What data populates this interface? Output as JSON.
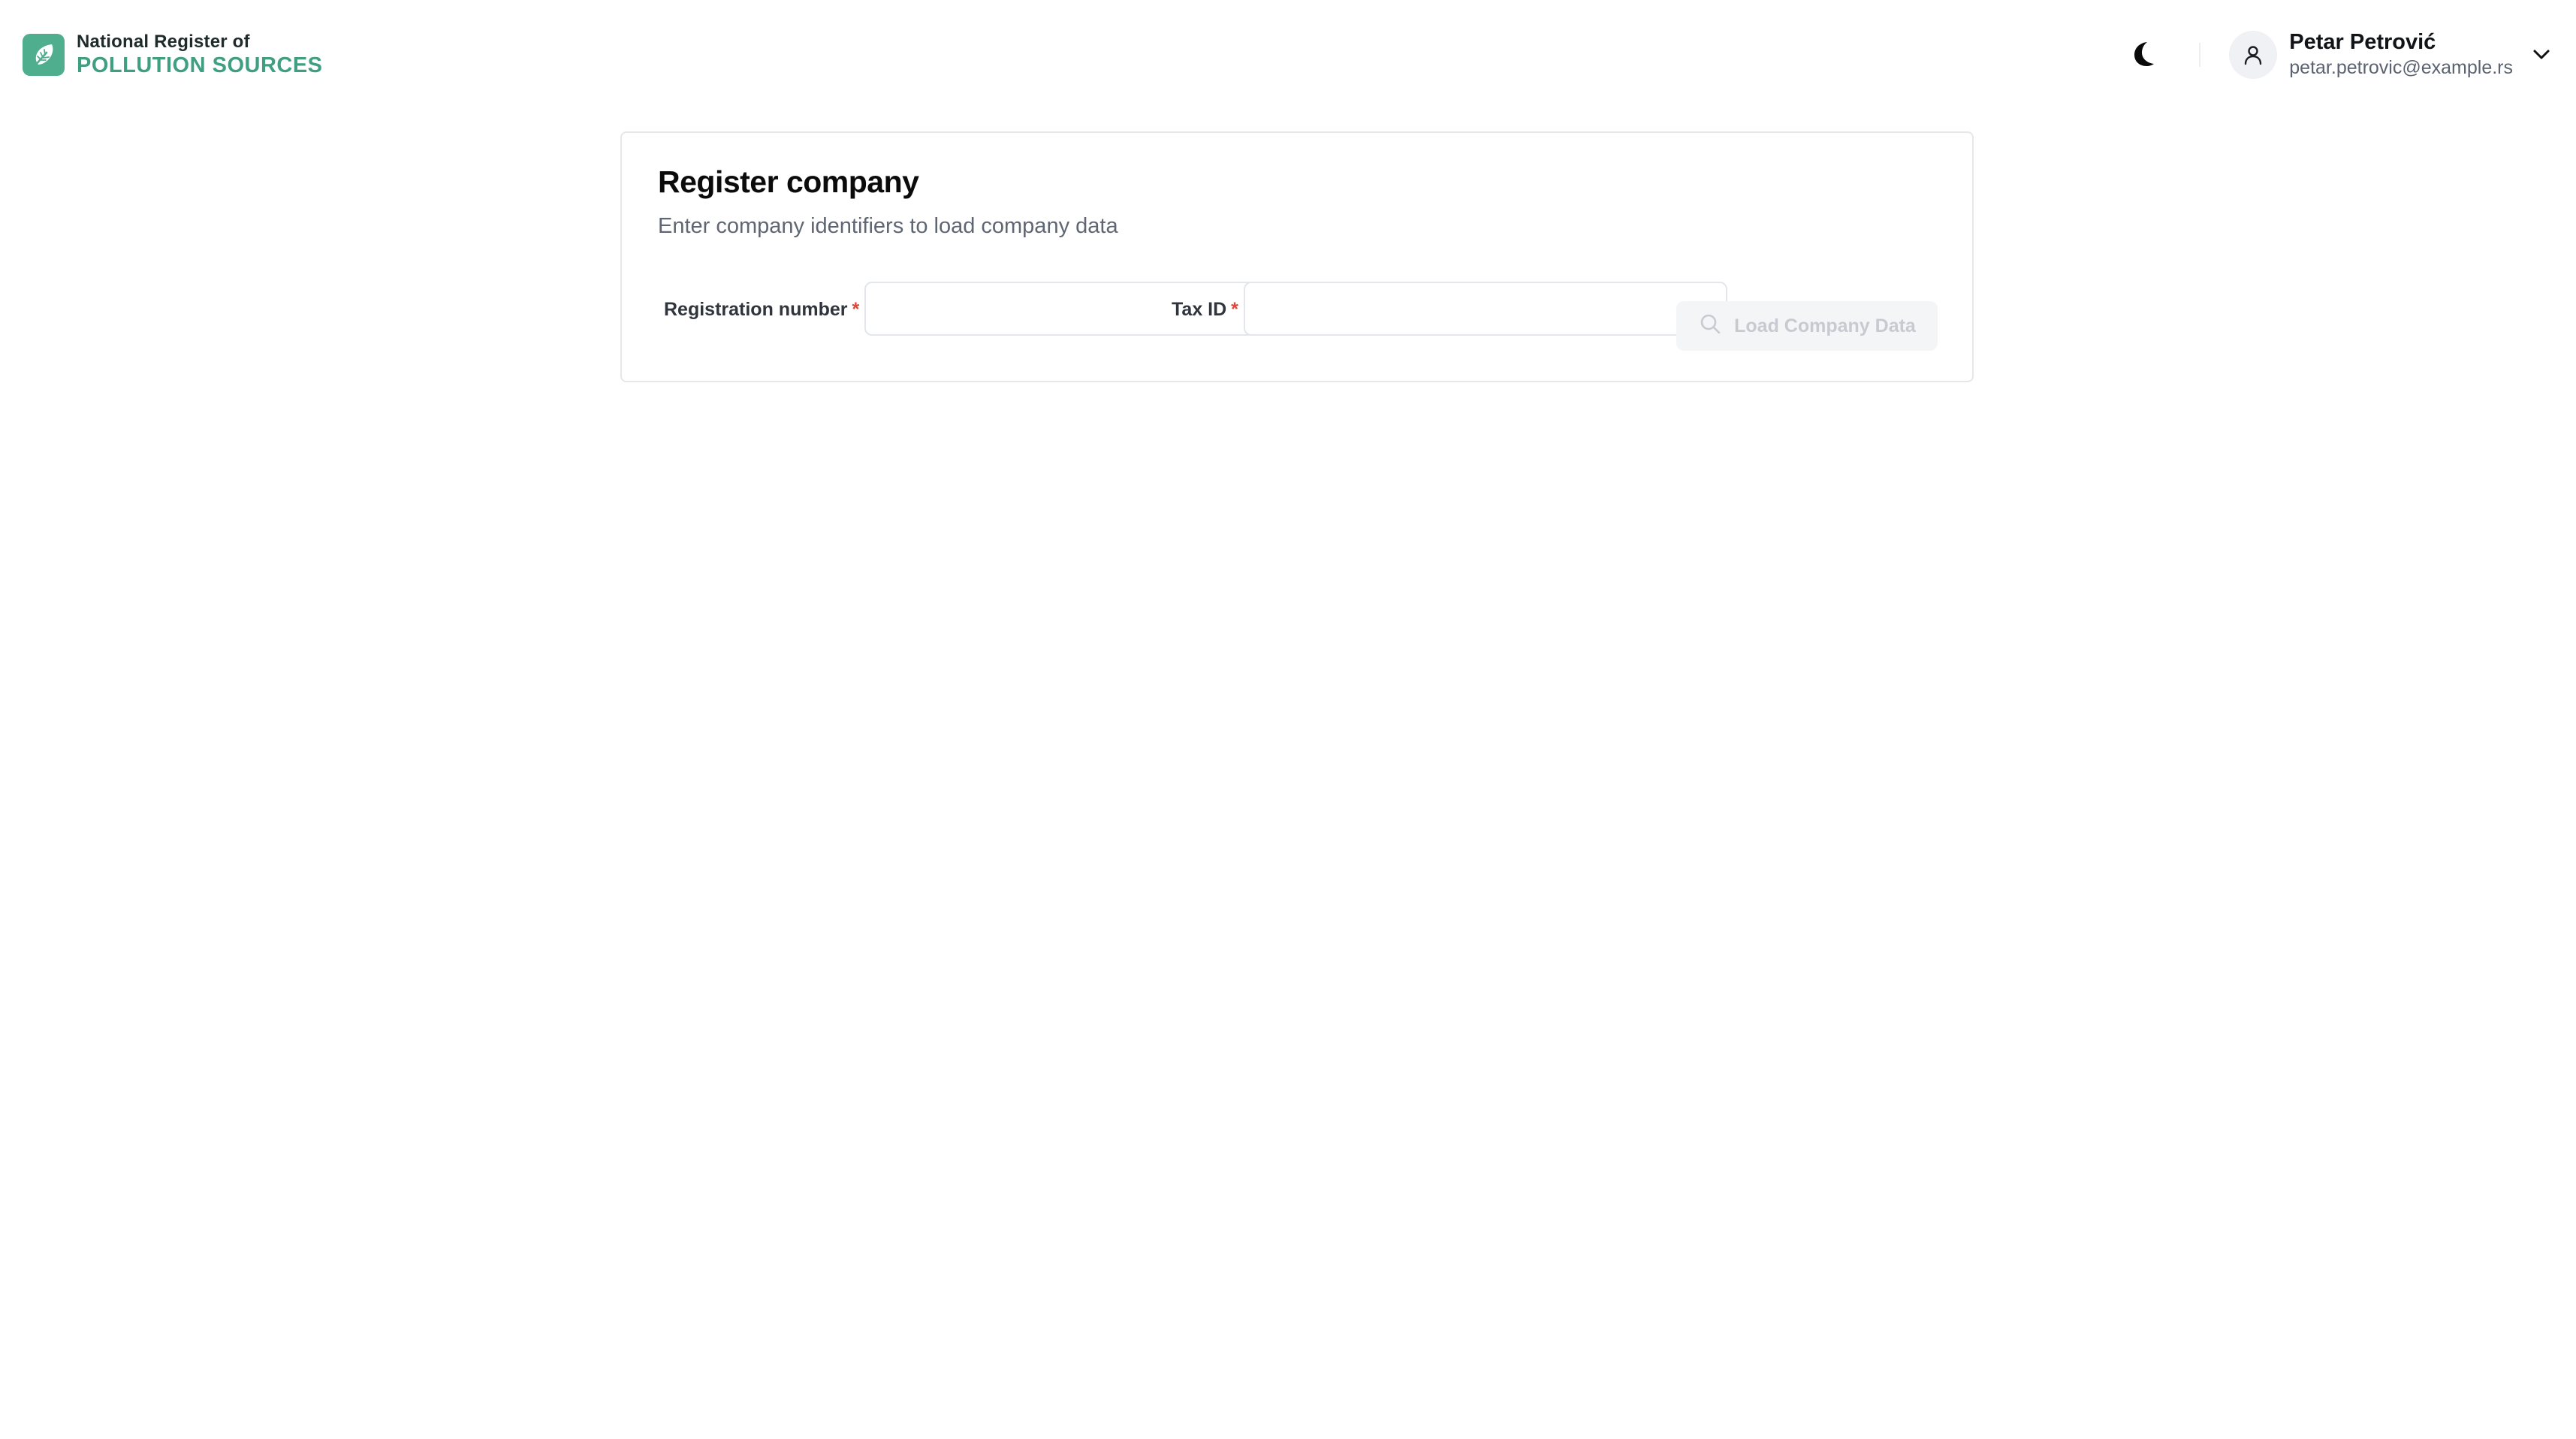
{
  "brand": {
    "line1": "National Register of",
    "line2": "POLLUTION SOURCES",
    "logo_icon": "leaf-icon",
    "accent_color": "#4fae8e"
  },
  "header": {
    "theme_toggle_icon": "moon-icon",
    "user": {
      "name": "Petar Petrović",
      "email": "petar.petrovic@example.rs",
      "avatar_icon": "user-icon",
      "menu_icon": "chevron-down-icon"
    }
  },
  "card": {
    "title": "Register company",
    "subtitle": "Enter company identifiers to load company data",
    "fields": {
      "registration": {
        "label": "Registration number",
        "required_mark": "*",
        "value": "",
        "placeholder": ""
      },
      "tax": {
        "label": "Tax ID",
        "required_mark": "*",
        "value": "",
        "placeholder": ""
      }
    },
    "load_button": {
      "label": "Load Company Data",
      "icon": "search-icon",
      "disabled": true
    }
  }
}
